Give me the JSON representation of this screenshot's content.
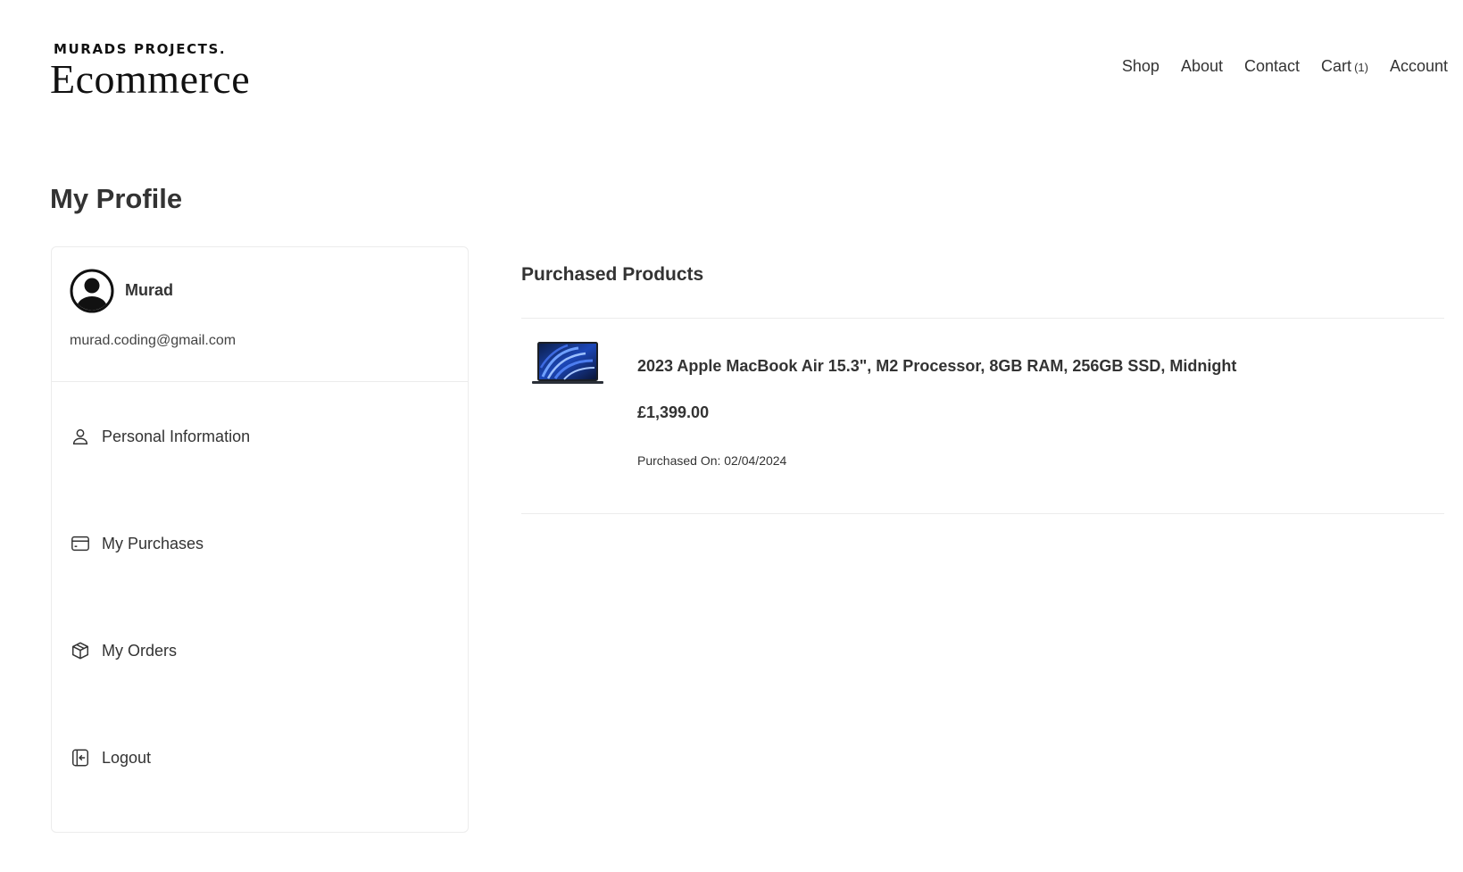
{
  "brand": {
    "tagline": "MURADS PROJECTS.",
    "name": "Ecommerce"
  },
  "nav": {
    "items": [
      {
        "label": "Shop"
      },
      {
        "label": "About"
      },
      {
        "label": "Contact"
      },
      {
        "label": "Cart",
        "count": "(1)"
      },
      {
        "label": "Account"
      }
    ]
  },
  "page": {
    "title": "My Profile"
  },
  "profile": {
    "avatar_icon": "user-circle-icon",
    "name": "Murad",
    "email": "murad.coding@gmail.com",
    "menu": [
      {
        "label": "Personal Information",
        "icon": "user-icon"
      },
      {
        "label": "My Purchases",
        "icon": "credit-card-icon"
      },
      {
        "label": "My Orders",
        "icon": "package-icon"
      },
      {
        "label": "Logout",
        "icon": "logout-icon"
      }
    ]
  },
  "purchases": {
    "title": "Purchased Products",
    "items": [
      {
        "name": "2023 Apple MacBook Air 15.3\", M2 Processor, 8GB RAM, 256GB SSD, Midnight",
        "price": "£1,399.00",
        "purchased_on": "Purchased On: 02/04/2024",
        "image_icon": "macbook-thumbnail"
      }
    ]
  },
  "colors": {
    "text": "#333333",
    "border": "#ececec",
    "background": "#ffffff"
  }
}
